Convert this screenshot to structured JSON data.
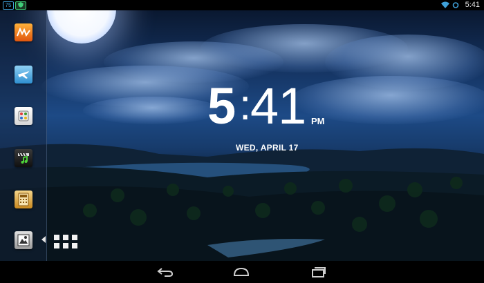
{
  "status_bar": {
    "notifications": [
      "75",
      "shield-icon"
    ],
    "time": "5:41",
    "icons": [
      "wifi-icon",
      "battery-icon"
    ]
  },
  "clock": {
    "hour": "5",
    "separator": ":",
    "minutes": "41",
    "ampm": "PM",
    "date": "WED, APRIL 17"
  },
  "dock": {
    "apps": [
      {
        "name": "music-app",
        "icon": "mp3-icon"
      },
      {
        "name": "airplane-app",
        "icon": "airplane-icon"
      },
      {
        "name": "game-app",
        "icon": "gamepad-icon"
      },
      {
        "name": "video-music-app",
        "icon": "clapper-icon"
      },
      {
        "name": "calculator-app",
        "icon": "calculator-icon"
      },
      {
        "name": "gallery-app",
        "icon": "picture-icon"
      }
    ],
    "drawer_icon": "app-grid-icon"
  },
  "nav_bar": {
    "buttons": [
      "back-icon",
      "home-icon",
      "recent-apps-icon"
    ]
  },
  "colors": {
    "accent": "#3fa0d8",
    "sky_top": "#0a1830",
    "sky_mid": "#1d4a86"
  }
}
